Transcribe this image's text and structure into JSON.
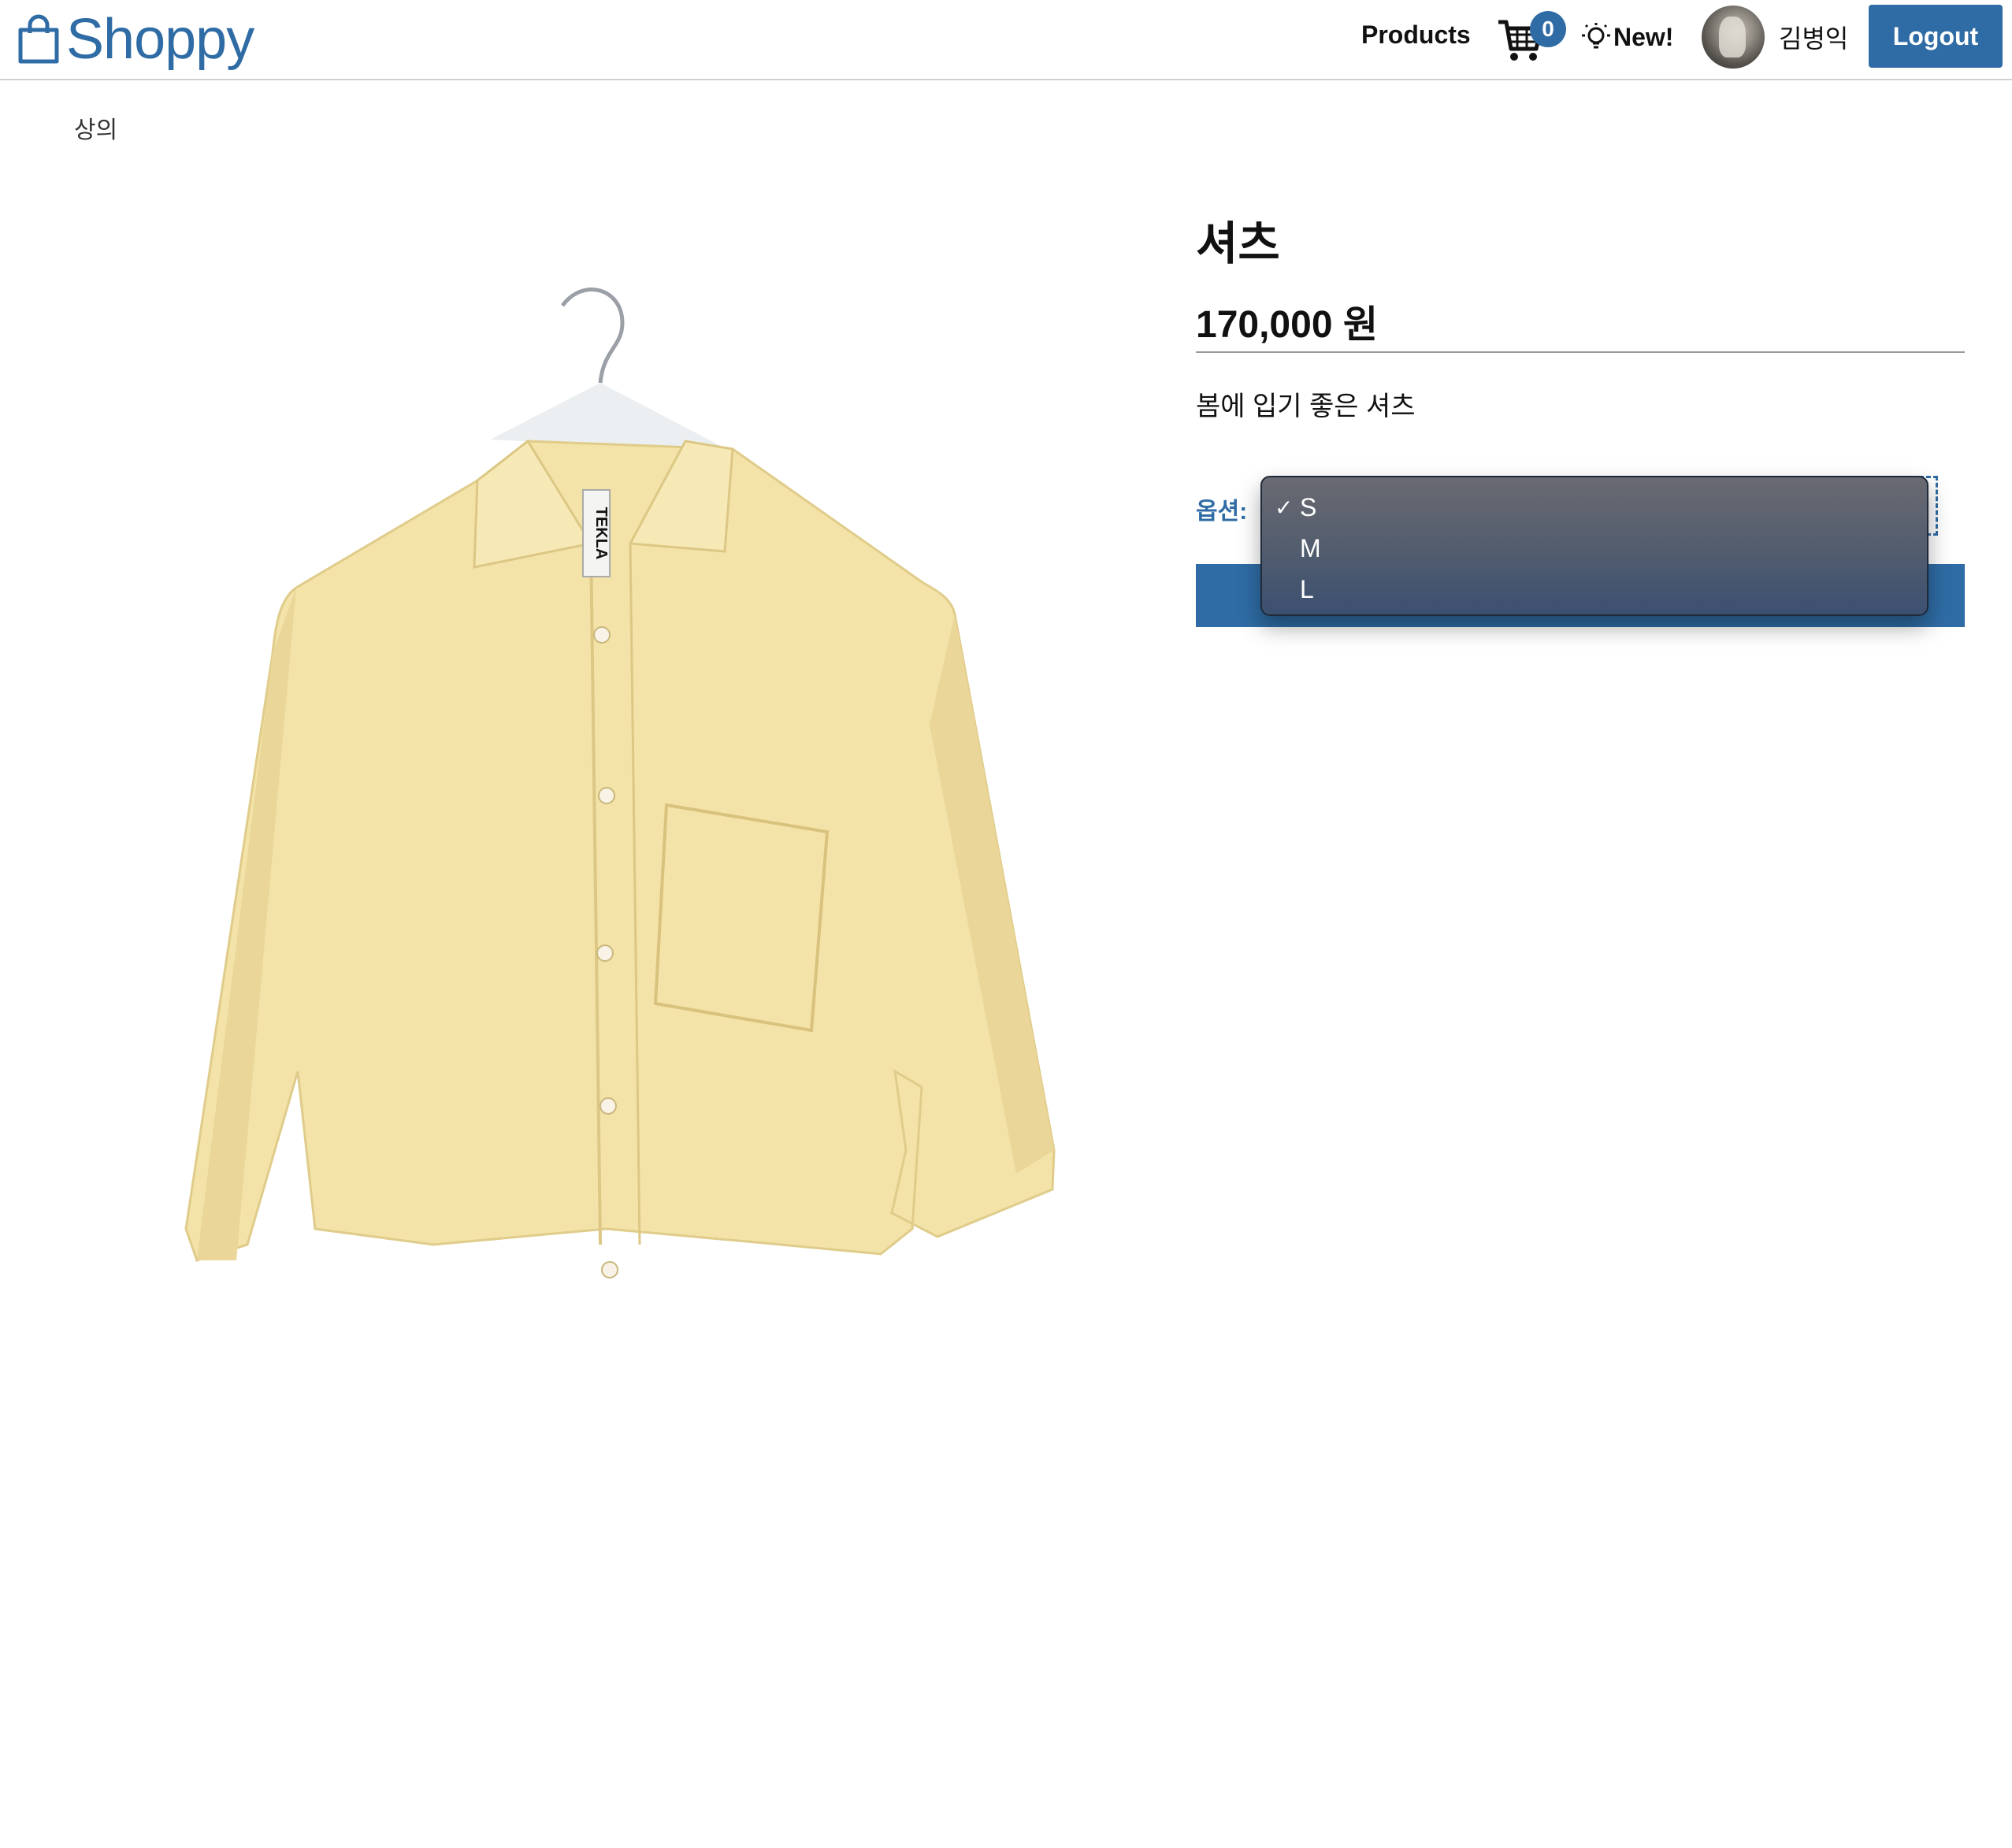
{
  "header": {
    "logo_text": "Shoppy",
    "nav_products": "Products",
    "cart_count": "0",
    "new_label": "New!",
    "username": "김병익",
    "logout_label": "Logout"
  },
  "breadcrumb": "상의",
  "product": {
    "title": "셔츠",
    "price": "170,000 원",
    "description": "봄에 입기 좋은 셔츠",
    "option_label": "옵션:",
    "hanger_tag_text": "TEKLA"
  },
  "dropdown": {
    "options": [
      "S",
      "M",
      "L"
    ],
    "selected_index": 0,
    "check_mark": "✓"
  },
  "colors": {
    "accent": "#2f6ca5",
    "shirt": "#f3e3a8"
  },
  "icons": {
    "logo": "shopping-bag-icon",
    "cart": "cart-icon",
    "new": "lightbulb-icon"
  }
}
